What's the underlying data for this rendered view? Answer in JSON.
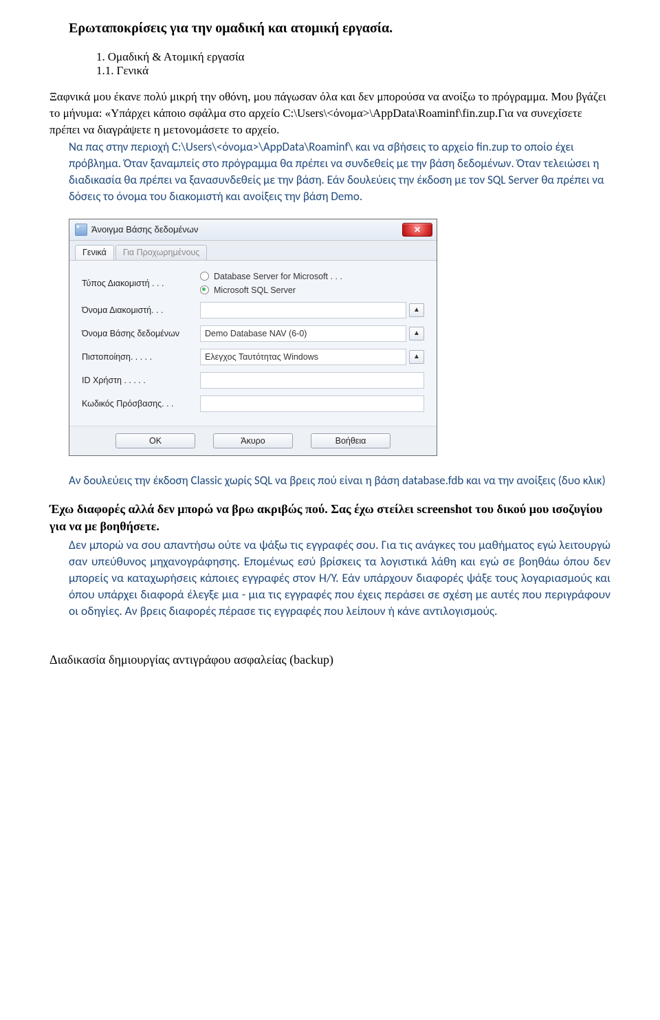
{
  "title": "Ερωταποκρίσεις για την ομαδική και ατομική εργασία.",
  "section_number1": "1.",
  "section_number2": "1.1.",
  "section_title1": "Ομαδική & Ατομική εργασία",
  "section_title2": "Γενικά",
  "q1_black": "Ξαφνικά μου έκανε πολύ μικρή την οθόνη, μου πάγωσαν όλα και δεν μπορούσα να ανοίξω το πρόγραμμα. Μου βγάζει το μήνυμα: «Υπάρχει κάποιο σφάλμα στο αρχείο C:\\Users\\<όνομα>\\AppData\\Roaminf\\fin.zup.Για να συνεχίσετε πρέπει να διαγράψετε η μετονομάσετε το αρχείο.",
  "q1_blue": "Να πας στην περιοχή C:\\Users\\<όνομα>\\AppData\\Roaminf\\ και να σβήσεις το αρχείο fin.zup το οποίο έχει πρόβλημα. Όταν ξαναμπείς στο πρόγραμμα θα πρέπει να συνδεθείς με την βάση δεδομένων. Όταν τελειώσει η διαδικασία θα πρέπει να ξανασυνδεθείς με την βάση. Εάν δουλεύεις την έκδοση με τον SQL Server θα πρέπει να δόσεις το όνομα του διακομιστή και ανοίξεις την βάση Demo.",
  "dialog": {
    "title": "Άνοιγμα Βάσης δεδομένων",
    "tab1": "Γενικά",
    "tab2": "Για Προχωρημένους",
    "rows": {
      "server_type": "Τύπος Διακομιστή . . .",
      "server_type_opt1": "Database Server for Microsoft . . .",
      "server_type_opt2": "Microsoft SQL Server",
      "server_name": "Όνομα Διακομιστή. . .",
      "db_name": "Όνομα Βάσης δεδομένων",
      "db_name_val": "Demo Database NAV (6-0)",
      "auth": "Πιστοποίηση. . . . .",
      "auth_val": "Ελεγχος Ταυτότητας Windows",
      "user_id": "ID Χρήστη . . . . .",
      "password": "Κωδικός Πρόσβασης. . ."
    },
    "buttons": {
      "ok": "OK",
      "cancel": "Άκυρο",
      "help": "Βοήθεια"
    }
  },
  "blue_after": "Αν δουλεύεις την έκδοση Classic χωρίς SQL να βρεις πού είναι η βάση database.fdb και να την ανοίξεις (δυο κλικ)",
  "q2_bold": "Έχω διαφορές αλλά δεν μπορώ να βρω ακριβώς πού. Σας έχω στείλει screenshot του δικού μου ισοζυγίου για να με βοηθήσετε.",
  "answer1": "Δεν μπορώ να σου απαντήσω ούτε να ψάξω τις εγγραφές σου. Για τις ανάγκες του μαθήματος εγώ λειτουργώ σαν υπεύθυνος μηχανογράφησης. Επομένως εσύ βρίσκεις τα λογιστικά λάθη και εγώ σε βοηθάω όπου δεν μπορείς να καταχωρήσεις κάποιες εγγραφές στον Η/Υ.  Εάν υπάρχουν διαφορές ψάξε τους λογαριασμούς και όπου υπάρχει διαφορά έλεγξε μια - μια τις εγγραφές που έχεις περάσει σε σχέση με αυτές που περιγράφουν οι οδηγίες. Αν βρεις διαφορές πέρασε τις εγγραφές που λείπουν ή κάνε αντιλογισμούς.",
  "backup_heading": "Διαδικασία δημιουργίας αντιγράφου ασφαλείας (backup)"
}
